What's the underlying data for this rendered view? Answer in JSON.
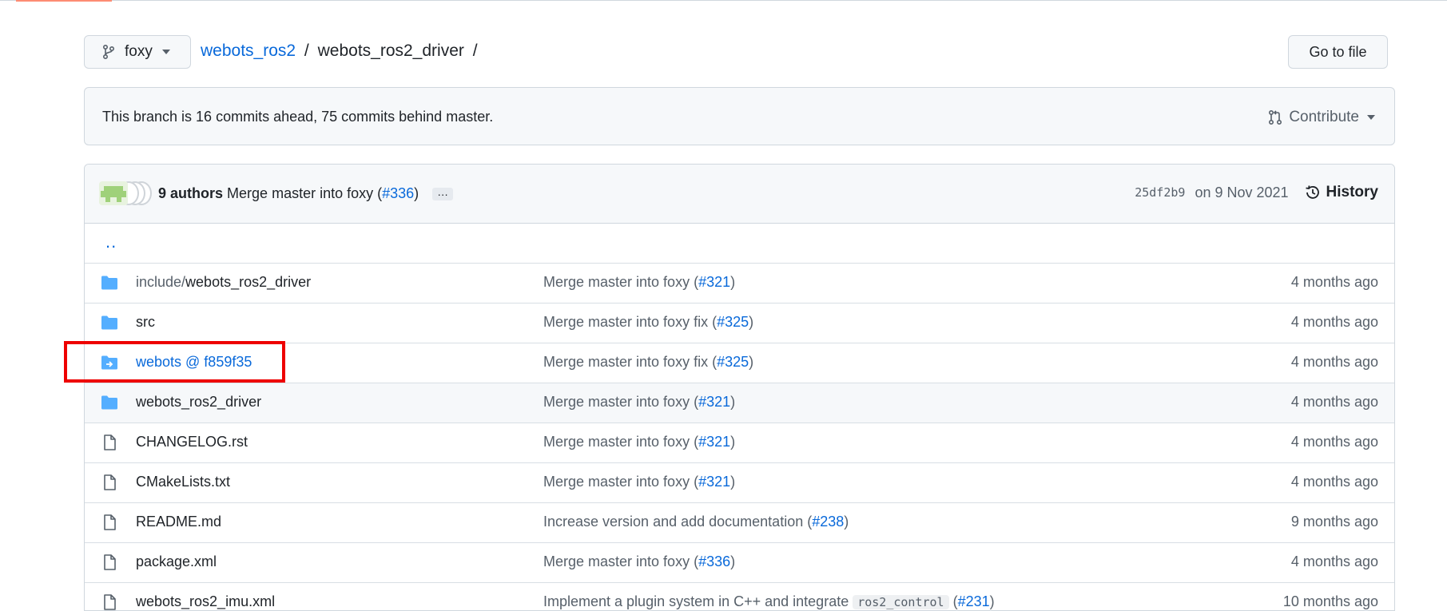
{
  "branch": {
    "name": "foxy"
  },
  "breadcrumb": {
    "repo": "webots_ros2",
    "sep1": "/",
    "folder": "webots_ros2_driver",
    "sep2": "/"
  },
  "go_to_file_label": "Go to file",
  "banner": {
    "message": "This branch is 16 commits ahead, 75 commits behind master.",
    "contribute_label": "Contribute"
  },
  "latest_commit": {
    "authors": "9 authors",
    "message_prefix": "Merge master into foxy (",
    "pr": "#336",
    "message_suffix": ")",
    "ellipsis": "…",
    "sha": "25df2b9",
    "date": "on 9 Nov 2021",
    "history_label": "History"
  },
  "parent_dir": "..",
  "files": [
    {
      "type": "dir",
      "name_prefix": "include/",
      "name": "webots_ros2_driver",
      "msg": "Merge master into foxy (",
      "pr": "#321",
      "msg_suffix": ")",
      "time": "4 months ago"
    },
    {
      "type": "dir",
      "name_prefix": "",
      "name": "src",
      "msg": "Merge master into foxy fix (",
      "pr": "#325",
      "msg_suffix": ")",
      "time": "4 months ago"
    },
    {
      "type": "submodule",
      "name_prefix": "",
      "name": "webots @ f859f35",
      "msg": "Merge master into foxy fix (",
      "pr": "#325",
      "msg_suffix": ")",
      "time": "4 months ago"
    },
    {
      "type": "dir",
      "name_prefix": "",
      "name": "webots_ros2_driver",
      "msg": "Merge master into foxy (",
      "pr": "#321",
      "msg_suffix": ")",
      "time": "4 months ago"
    },
    {
      "type": "file",
      "name_prefix": "",
      "name": "CHANGELOG.rst",
      "msg": "Merge master into foxy (",
      "pr": "#321",
      "msg_suffix": ")",
      "time": "4 months ago"
    },
    {
      "type": "file",
      "name_prefix": "",
      "name": "CMakeLists.txt",
      "msg": "Merge master into foxy (",
      "pr": "#321",
      "msg_suffix": ")",
      "time": "4 months ago"
    },
    {
      "type": "file",
      "name_prefix": "",
      "name": "README.md",
      "msg": "Increase version and add documentation (",
      "pr": "#238",
      "msg_suffix": ")",
      "time": "9 months ago"
    },
    {
      "type": "file",
      "name_prefix": "",
      "name": "package.xml",
      "msg": "Merge master into foxy (",
      "pr": "#336",
      "msg_suffix": ")",
      "time": "4 months ago"
    },
    {
      "type": "file",
      "name_prefix": "",
      "name": "webots_ros2_imu.xml",
      "msg": "Implement a plugin system in C++ and integrate ",
      "code": "ros2_control",
      "pr": "#231",
      "msg_suffix": ")",
      "time": "10 months ago"
    }
  ],
  "colors": {
    "link": "#0969da",
    "folder": "#54aeff",
    "highlight": "#ee0000",
    "border": "#d0d7de"
  },
  "icons": {
    "branch": "git-branch-icon",
    "contribute": "pull-request-icon",
    "history": "history-icon",
    "folder": "folder-icon",
    "submodule": "submodule-folder-icon",
    "file": "file-icon"
  }
}
